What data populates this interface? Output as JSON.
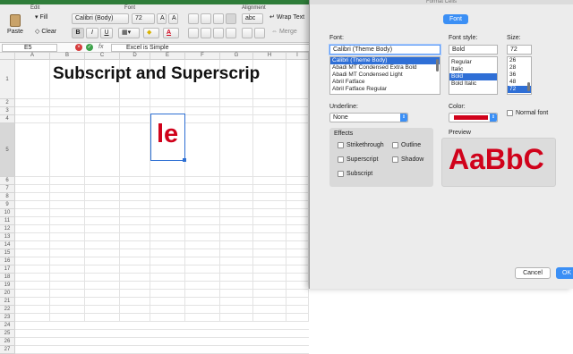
{
  "ribbon": {
    "groups": {
      "edit": "Edit",
      "font": "Font",
      "alignment": "Alignment"
    },
    "paste": "Paste",
    "fill": "Fill",
    "clear": "Clear",
    "font_name": "Calibri (Body)",
    "font_size": "72",
    "bold": "B",
    "italic": "I",
    "underline": "U",
    "wrap_text": "Wrap Text",
    "merge": "Merge",
    "abc": "abc"
  },
  "formula_bar": {
    "name_box": "E5",
    "fx": "fx",
    "content": "Excel is Simple"
  },
  "sheet": {
    "columns": [
      "A",
      "B",
      "C",
      "D",
      "E",
      "F",
      "G",
      "H",
      "I"
    ],
    "rows": [
      "1",
      "2",
      "3",
      "4",
      "5",
      "6",
      "7",
      "8",
      "9",
      "10",
      "11",
      "12",
      "13",
      "14",
      "15",
      "16",
      "17",
      "18",
      "19",
      "20",
      "21",
      "22",
      "23",
      "24",
      "25",
      "26",
      "27"
    ],
    "title": "Subscript and Superscrip",
    "active_cell_text": "le"
  },
  "dialog": {
    "title": "Format Cells",
    "tab": "Font",
    "font_label": "Font:",
    "font_value": "Calibri (Theme Body)",
    "font_list": [
      "Calibri (Theme Body)",
      "Abadi MT Condensed Extra Bold",
      "Abadi MT Condensed Light",
      "Abril Fatface",
      "Abril Fatface Regular"
    ],
    "font_style_label": "Font style:",
    "font_style_value": "Bold",
    "font_styles": [
      "Regular",
      "Italic",
      "Bold",
      "Bold Italic"
    ],
    "size_label": "Size:",
    "size_value": "72",
    "sizes": [
      "26",
      "28",
      "36",
      "48",
      "72"
    ],
    "underline_label": "Underline:",
    "underline_value": "None",
    "color_label": "Color:",
    "normal_font": "Normal font",
    "effects_label": "Effects",
    "effects": {
      "strikethrough": "Strikethrough",
      "outline": "Outline",
      "superscript": "Superscript",
      "shadow": "Shadow",
      "subscript": "Subscript"
    },
    "preview_label": "Preview",
    "preview_text": "AaBbC",
    "cancel": "Cancel",
    "ok": "OK"
  },
  "colors": {
    "accent": "#3b8ff5",
    "font_color": "#d0021b",
    "excel_green": "#2f7d3a"
  }
}
